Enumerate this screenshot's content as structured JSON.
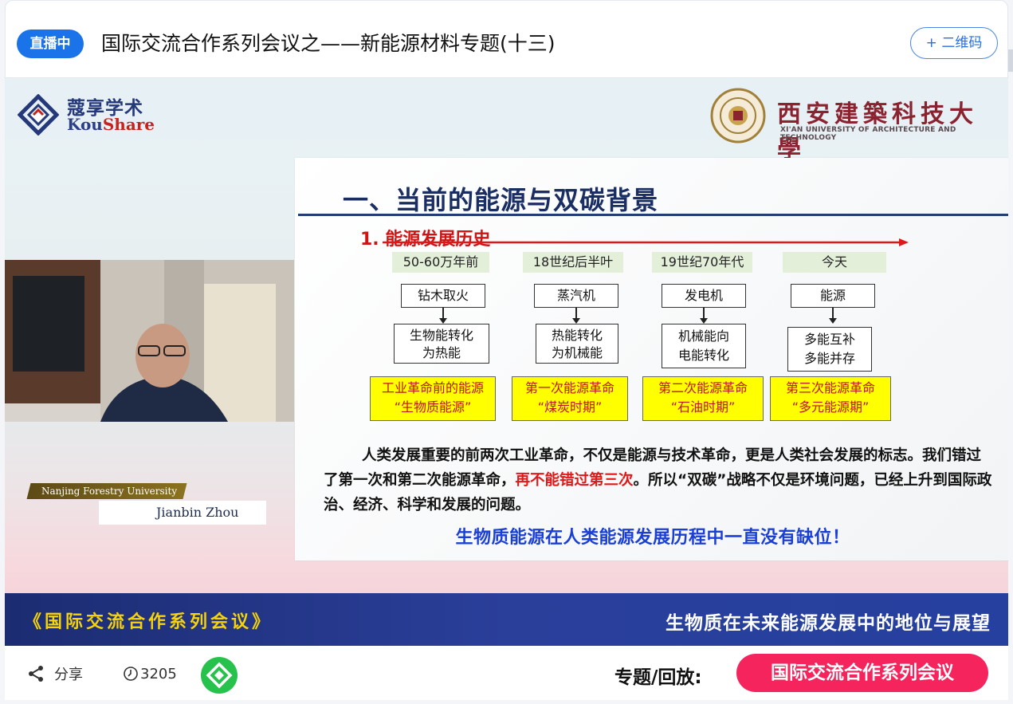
{
  "header": {
    "live_badge": "直播中",
    "title": "国际交流合作系列会议之——新能源材料专题(十三)",
    "qr_button": "+ 二维码"
  },
  "logos": {
    "kou_cn": "蔻享学术",
    "kou_en_a": "Kou",
    "kou_en_b": "Share",
    "xauat_cn": "西安建築科技大學",
    "xauat_en": "XI'AN UNIVERSITY OF ARCHITECTURE AND TECHNOLOGY"
  },
  "slide": {
    "heading": "一、当前的能源与双碳背景",
    "section_title": "1. 能源发展历史",
    "stages": [
      {
        "era": "50-60万年前",
        "step1": "钻木取火",
        "step2_a": "生物能转化",
        "step2_b": "为热能",
        "rev_a": "工业革命前的能源",
        "rev_b": "“生物质能源”"
      },
      {
        "era": "18世纪后半叶",
        "step1": "蒸汽机",
        "step2_a": "热能转化",
        "step2_b": "为机械能",
        "rev_a": "第一次能源革命",
        "rev_b": "“煤炭时期”"
      },
      {
        "era": "19世纪70年代",
        "step1": "发电机",
        "step2_a": "机械能向",
        "step2_b": "电能转化",
        "rev_a": "第二次能源革命",
        "rev_b": "“石油时期”"
      },
      {
        "era": "今天",
        "step1": "能源",
        "step2_a": "多能互补",
        "step2_b": "多能并存",
        "rev_a": "第三次能源革命",
        "rev_b": "“多元能源期”"
      }
    ],
    "para_part1": "人类发展重要的前两次工业革命，不仅是能源与技术革命，更是人类社会发展的标志。我们错过了第一次和第二次能源革命，",
    "para_highlight": "再不能错过第三次",
    "para_part2": "。所以“双碳”战略不仅是环境问题，已经上升到国际政治、经济、科学和发展的问题。",
    "conclusion": "生物质能源在人类能源发展历程中一直没有缺位！"
  },
  "speaker": {
    "institution": "Nanjing Forestry University",
    "name": "Jianbin Zhou"
  },
  "banner": {
    "left": "《国际交流合作系列会议》",
    "right": "生物质在未来能源发展中的地位与展望"
  },
  "footer": {
    "share_label": "分享",
    "views": "3205",
    "topic_label": "专题/回放:",
    "topic_link": "国际交流合作系列会议"
  },
  "colors": {
    "live_blue": "#1a73e8",
    "topic_pink": "#f5245c",
    "banner_navy": "#1c2c72",
    "highlight_yellow": "#ffff00",
    "alert_red": "#e01818",
    "conclusion_blue": "#1a3fd6"
  },
  "icons": {
    "share": "share-icon",
    "views": "views-clock-icon",
    "green": "app-logo-icon"
  }
}
